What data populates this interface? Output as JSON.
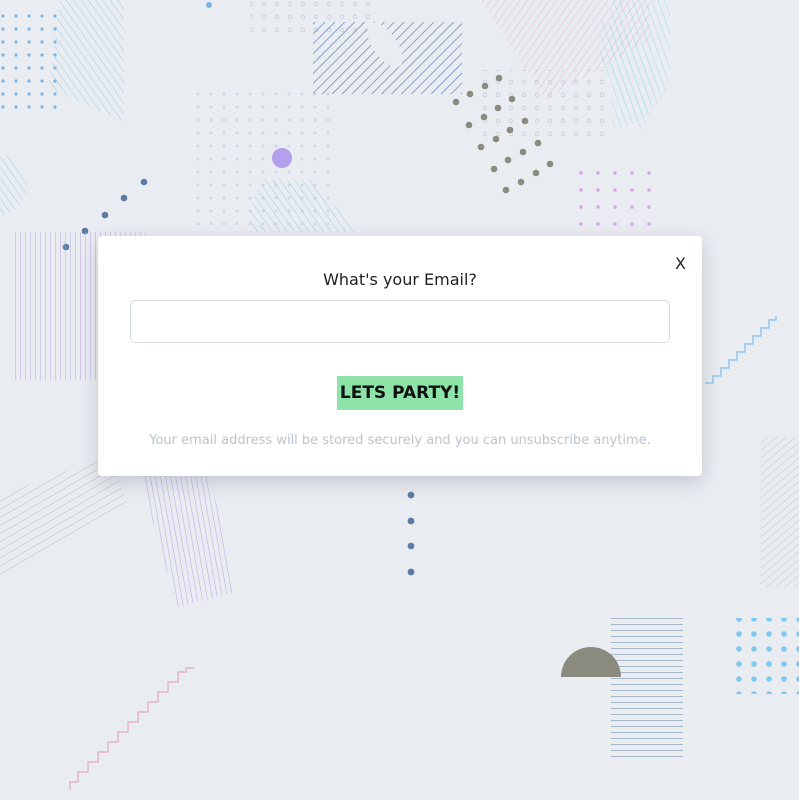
{
  "modal": {
    "close_label": "X",
    "title": "What's your Email?",
    "email": {
      "value": "",
      "placeholder": ""
    },
    "cta_label": "LETS PARTY!",
    "disclaimer": "Your email address will be stored securely and you can unsubscribe anytime."
  },
  "colors": {
    "background": "#e9ecf1",
    "cta": "#8ee3a8",
    "disclaimer_text": "#bcc3ce"
  },
  "icons": [
    "close-icon"
  ]
}
